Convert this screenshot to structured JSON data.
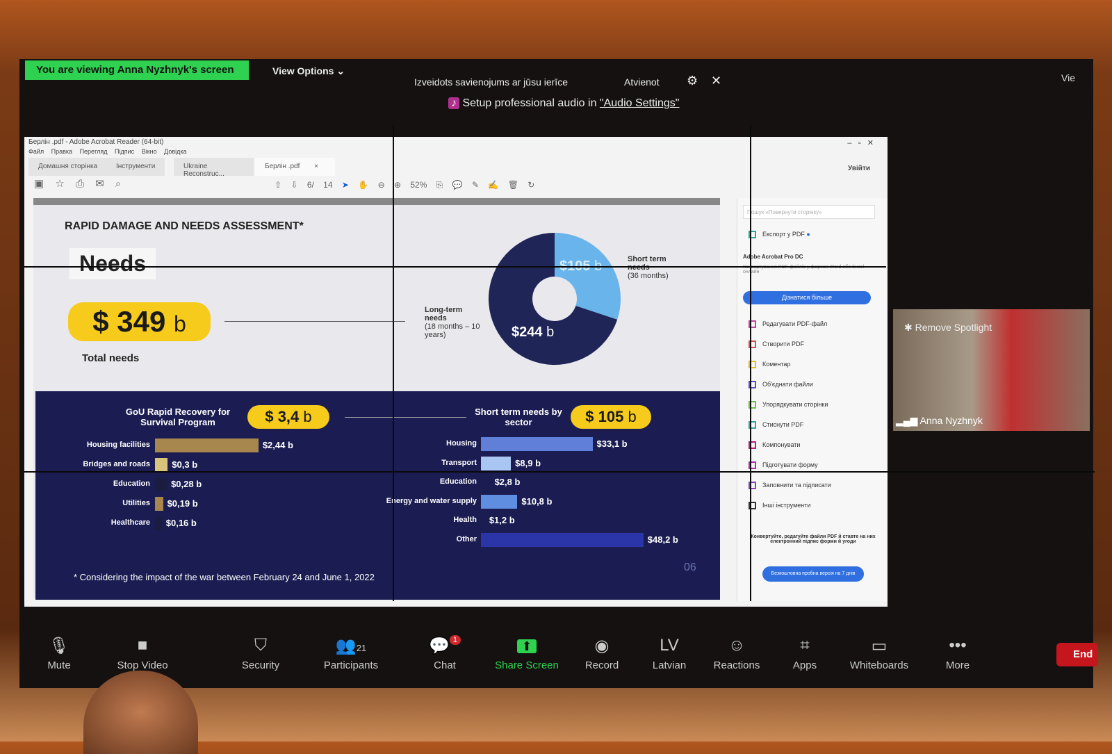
{
  "zoom": {
    "viewing_banner": "You are viewing Anna Nyzhnyk's screen",
    "view_options": "View Options ⌄",
    "connection_text": "Izveidots savienojums ar jūsu ierīce",
    "disconnect": "Atvienot",
    "audio_prefix": "Setup professional audio in ",
    "audio_link": "\"Audio Settings\"",
    "view_right": "Vie",
    "video_tile": {
      "remove_spotlight": "Remove Spotlight",
      "name": "Anna Nyzhnyk"
    },
    "toolbar": [
      {
        "label": "Mute",
        "icon": "microphone-icon",
        "glyph": "🎙"
      },
      {
        "label": "Stop Video",
        "icon": "video-camera-icon",
        "glyph": "■"
      },
      {
        "label": "Security",
        "icon": "shield-icon",
        "glyph": "⛉"
      },
      {
        "label": "Participants",
        "icon": "participants-icon",
        "glyph": "👥",
        "count": "21"
      },
      {
        "label": "Chat",
        "icon": "chat-icon",
        "glyph": "💬",
        "badge": "1"
      },
      {
        "label": "Share Screen",
        "icon": "share-screen-icon",
        "glyph": "⬆"
      },
      {
        "label": "Record",
        "icon": "record-icon",
        "glyph": "◉"
      },
      {
        "label": "Latvian",
        "icon": "language-icon",
        "glyph": "LV"
      },
      {
        "label": "Reactions",
        "icon": "reactions-icon",
        "glyph": "☺"
      },
      {
        "label": "Apps",
        "icon": "apps-icon",
        "glyph": "⌗"
      },
      {
        "label": "Whiteboards",
        "icon": "whiteboard-icon",
        "glyph": "▭"
      },
      {
        "label": "More",
        "icon": "more-icon",
        "glyph": "•••"
      }
    ],
    "end": "End",
    "share_color": "#2fd150"
  },
  "acrobat": {
    "title": "Берлін .pdf - Adobe Acrobat Reader (64-bit)",
    "menu": [
      "Файл",
      "Правка",
      "Перегляд",
      "Підпис",
      "Вікно",
      "Довідка"
    ],
    "tabs": [
      "Домашня сторінка",
      "Інструменти",
      "Ukraine Reconstruc...",
      "Берлін .pdf"
    ],
    "sign_in": "Увійти",
    "page_current": "6",
    "page_total": "/ 14",
    "zoom": "52%",
    "sidebar": {
      "search_placeholder": "Пошук «Повернути сторінку»",
      "export": "Експорт у PDF",
      "pro_title": "Adobe Acrobat Pro DC",
      "pro_desc": "Конвертування PDF-файлів у формат Word або Excel онлайн",
      "learn_more": "Дізнатися більше",
      "tools": [
        {
          "label": "Редагувати PDF-файл",
          "color": "#c23fa0"
        },
        {
          "label": "Створити PDF",
          "color": "#d94a4a"
        },
        {
          "label": "Коментар",
          "color": "#e0c020"
        },
        {
          "label": "Об'єднати файли",
          "color": "#5a4bd1"
        },
        {
          "label": "Упорядкувати сторінки",
          "color": "#6cc04a"
        },
        {
          "label": "Стиснути PDF",
          "color": "#2aa7a0"
        },
        {
          "label": "Компонувати",
          "color": "#c2187a"
        },
        {
          "label": "Підготувати форму",
          "color": "#b02cb0"
        },
        {
          "label": "Заповнити та підписати",
          "color": "#8a3cc9"
        },
        {
          "label": "Інші інструменти",
          "color": "#333333"
        }
      ],
      "promo": "Конвертуйте, редагуйте файли PDF й ставте на них електронний підпис форми й угоди",
      "trial": "Безкоштовна пробна версія на 7 днів"
    }
  },
  "slide": {
    "heading": "RAPID DAMAGE AND NEEDS ASSESSMENT*",
    "needs": "Needs",
    "total_value": "$ 349",
    "total_unit": "b",
    "total_label": "Total needs",
    "long_term": {
      "title": "Long-term needs",
      "sub": "(18 months – 10 years)",
      "value": "$244",
      "unit": "b"
    },
    "short_term": {
      "title": "Short term needs",
      "sub": "(36 months)",
      "value": "$105",
      "unit": "b"
    },
    "gou_title": "GoU Rapid Recovery for Survival Program",
    "gou_value": "$ 3,4",
    "gou_unit": "b",
    "sector_title": "Short term needs by sector",
    "sector_value": "$ 105",
    "sector_unit": "b",
    "footnote": "* Considering the impact of the war between February 24 and June 1, 2022",
    "page_no": "06"
  },
  "chart_data": [
    {
      "type": "pie",
      "values": [
        244,
        105
      ],
      "labels": [
        "Long-term needs",
        "Short term needs"
      ],
      "colors": [
        "#1f2556",
        "#6ab4ec"
      ]
    },
    {
      "type": "bar",
      "title": "GoU Rapid Recovery for Survival Program",
      "categories": [
        "Housing facilities",
        "Bridges and roads",
        "Education",
        "Utilities",
        "Healthcare"
      ],
      "values": [
        2.44,
        0.3,
        0.28,
        0.19,
        0.16
      ],
      "labels": [
        "$2,44 b",
        "$0,3 b",
        "$0,28 b",
        "$0,19 b",
        "$0,16 b"
      ],
      "colors": [
        "#a8874f",
        "#d8c47a",
        "#1b1d40",
        "#a8874f",
        "#1b1d40"
      ]
    },
    {
      "type": "bar",
      "title": "Short term needs by sector",
      "categories": [
        "Housing",
        "Transport",
        "Education",
        "Energy and water supply",
        "Health",
        "Other"
      ],
      "values": [
        33.1,
        8.9,
        2.8,
        10.8,
        1.2,
        48.2
      ],
      "labels": [
        "$33,1 b",
        "$8,9 b",
        "$2,8 b",
        "$10,8 b",
        "$1,2 b",
        "$48,2 b"
      ],
      "colors": [
        "#5f7fd8",
        "#a9c6f2",
        "#1b1d52",
        "#5f8ee0",
        "#1b1d52",
        "#2c35a8"
      ]
    }
  ]
}
